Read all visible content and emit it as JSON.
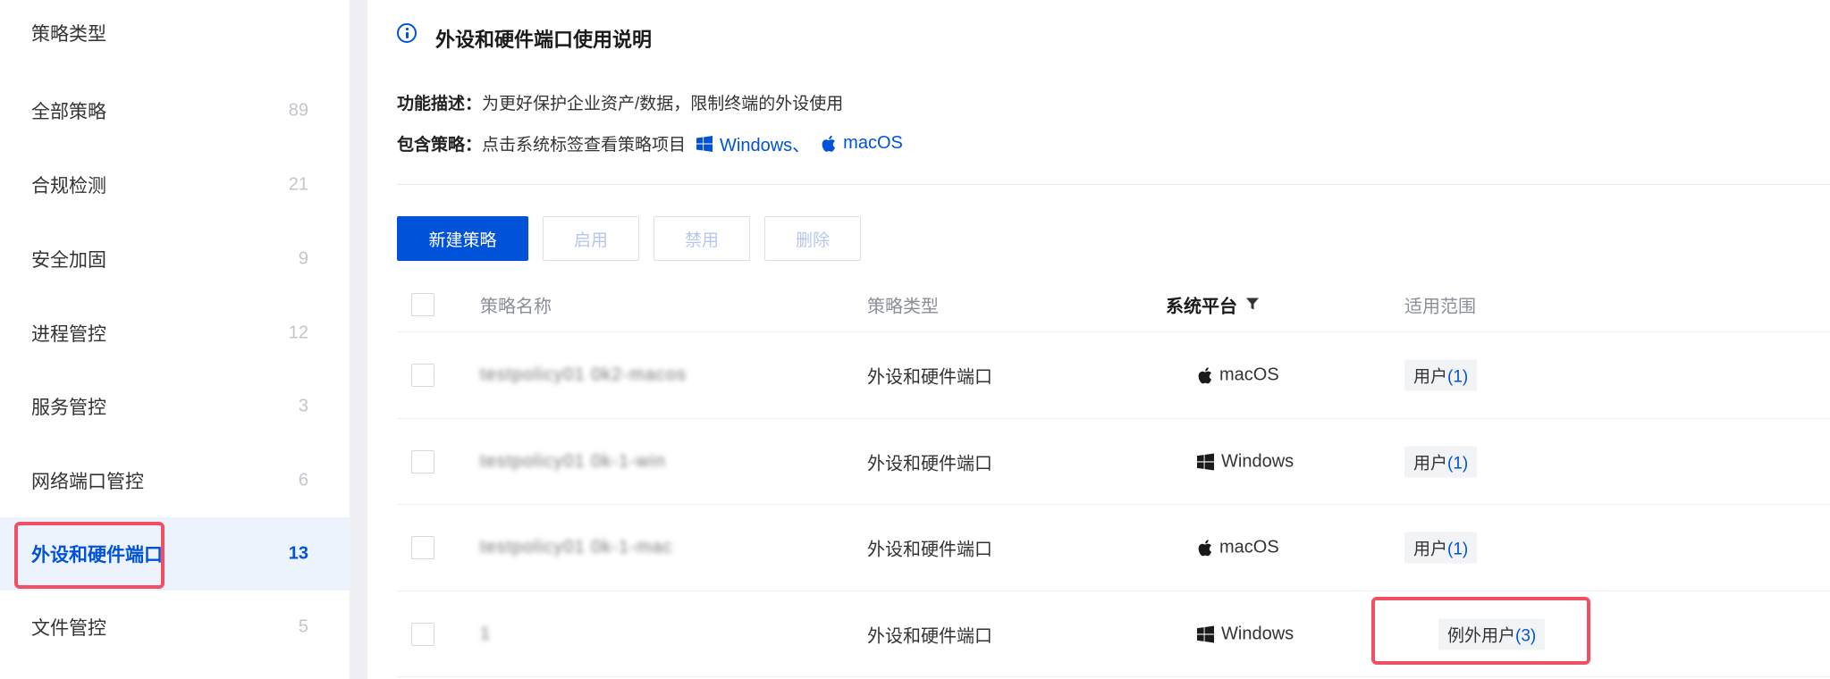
{
  "sidebar": {
    "title": "策略类型",
    "items": [
      {
        "label": "全部策略",
        "count": "89"
      },
      {
        "label": "合规检测",
        "count": "21"
      },
      {
        "label": "安全加固",
        "count": "9"
      },
      {
        "label": "进程管控",
        "count": "12"
      },
      {
        "label": "服务管控",
        "count": "3"
      },
      {
        "label": "网络端口管控",
        "count": "6"
      },
      {
        "label": "外设和硬件端口",
        "count": "13"
      },
      {
        "label": "文件管控",
        "count": "5"
      }
    ],
    "active_index": 6
  },
  "info": {
    "title": "外设和硬件端口使用说明",
    "desc_label": "功能描述：",
    "desc_text": "为更好保护企业资产/数据，限制终端的外设使用",
    "incl_label": "包含策略：",
    "incl_text": "点击系统标签查看策略项目",
    "platform_windows": "Windows、",
    "platform_macos": "macOS"
  },
  "toolbar": {
    "new_label": "新建策略",
    "enable_label": "启用",
    "disable_label": "禁用",
    "delete_label": "删除"
  },
  "table": {
    "headers": {
      "name": "策略名称",
      "type": "策略类型",
      "platform": "系统平台",
      "scope": "适用范围"
    },
    "rows": [
      {
        "name": "testpolicy01 0k2-macos",
        "type": "外设和硬件端口",
        "platform": "macOS",
        "platform_icon": "apple-icon",
        "scope_label": "用户",
        "scope_count": "(1)"
      },
      {
        "name": "testpolicy01 0k-1-win",
        "type": "外设和硬件端口",
        "platform": "Windows",
        "platform_icon": "windows-icon",
        "scope_label": "用户",
        "scope_count": "(1)"
      },
      {
        "name": "testpolicy01 0k-1-mac",
        "type": "外设和硬件端口",
        "platform": "macOS",
        "platform_icon": "apple-icon",
        "scope_label": "用户",
        "scope_count": "(1)"
      },
      {
        "name": "1",
        "type": "外设和硬件端口",
        "platform": "Windows",
        "platform_icon": "windows-icon",
        "scope_label": "例外用户",
        "scope_count": "(3)"
      }
    ]
  },
  "colors": {
    "primary": "#0052d9",
    "highlight": "#f05064",
    "active_bg": "#edf3fd"
  }
}
